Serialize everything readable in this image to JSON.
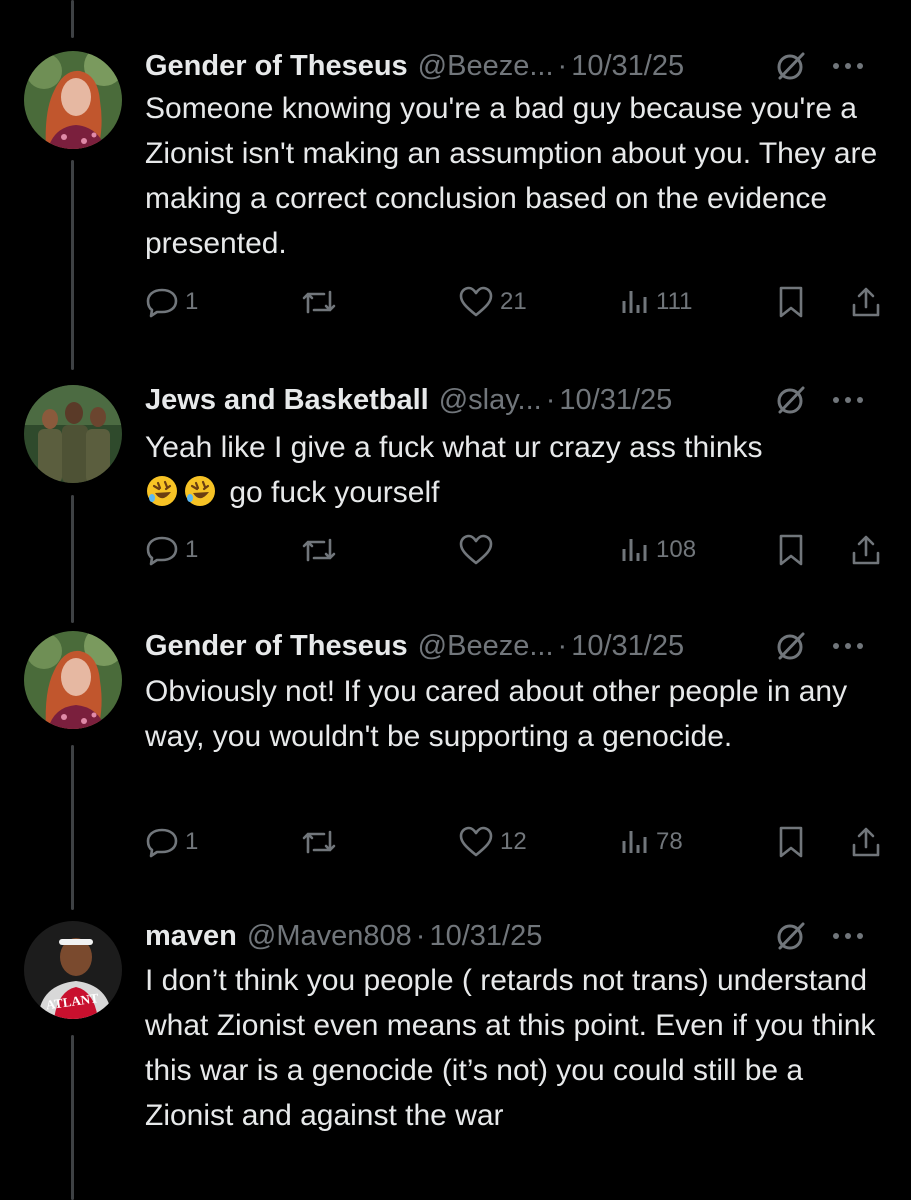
{
  "tweets": [
    {
      "author": "Gender of Theseus",
      "handle": "@Beeze...",
      "date": "10/31/25",
      "text": "Someone knowing you're a bad guy because you're a Zionist isn't making an assumption about you. They are making a correct conclusion based on the evidence presented.",
      "replies": "1",
      "likes": "21",
      "views": "111",
      "avatar": "red-haired-person-avatar"
    },
    {
      "author": "Jews and Basketball",
      "handle": "@slay...",
      "date": "10/31/25",
      "text_part1": "Yeah like I give a fuck what ur crazy ass thinks",
      "text_part2": "go fuck yourself",
      "emoji": "rolling-on-floor-laughing-emoji",
      "replies": "1",
      "likes": "",
      "views": "108",
      "avatar": "soldiers-group-avatar"
    },
    {
      "author": "Gender of Theseus",
      "handle": "@Beeze...",
      "date": "10/31/25",
      "text": "Obviously not! If you cared about other people in any way, you wouldn't be supporting a genocide.",
      "replies": "1",
      "likes": "12",
      "views": "78",
      "avatar": "red-haired-person-avatar"
    },
    {
      "author": "maven",
      "handle": "@Maven808",
      "date": "10/31/25",
      "text": "I don’t think you people ( retards not trans) understand what Zionist even means at this point. Even if you think this war is a genocide (it’s not) you could still be a Zionist and against the war",
      "avatar_text": "ATLANT",
      "avatar": "basketball-player-avatar"
    }
  ],
  "colors": {
    "background": "#000000",
    "text": "#e7e9ea",
    "muted": "#71767b",
    "thread_line": "#3e4144"
  }
}
